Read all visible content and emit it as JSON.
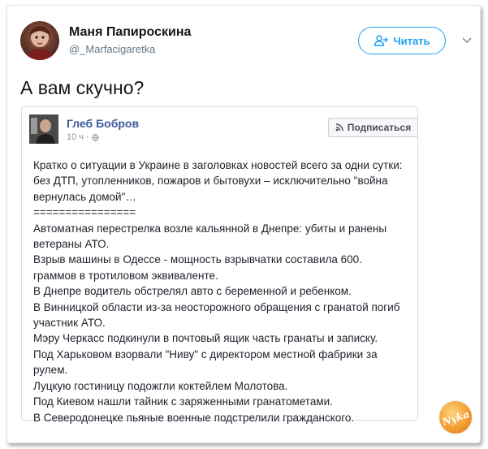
{
  "tweet": {
    "author_name": "Маня Папироскина",
    "author_handle": "@_Marfacigaretka",
    "follow_label": "Читать",
    "text": "А вам скучно?"
  },
  "quote": {
    "author_name": "Глеб Бобров",
    "time": "10 ч",
    "subscribe_label": "Подписаться",
    "lines": [
      "Кратко о ситуации в Украине в заголовках новостей всего за одни сутки:",
      "без ДТП, утопленников, пожаров и бытовухи – исключительно \"война",
      "вернулась домой\"…",
      "================",
      "Автоматная перестрелка возле кальянной в Днепре: убиты и ранены",
      "ветераны АТО.",
      "Взрыв машины в Одессе - мощность взрывчатки составила 600.",
      "граммов в тротиловом эквиваленте.",
      "В Днепре водитель обстрелял авто с беременной и ребенком.",
      "В Винницкой области из-за неосторожного обращения с гранатой погиб",
      "участник АТО.",
      "Мэру Черкасс подкинули в почтовый ящик часть гранаты и записку.",
      "Под Харьковом взорвали \"Ниву\" с директором местной фабрики за",
      "рулем.",
      "Луцкую гостиницу подожгли коктейлем Молотова.",
      "Под Киевом нашли тайник с заряженными гранатометами.",
      "В Северодонецке пьяные военные подстрелили гражданского."
    ]
  },
  "watermark": {
    "text": "Nyka"
  },
  "colors": {
    "twitter_blue": "#1da1f2",
    "facebook_link": "#3b5998",
    "muted": "#657786"
  }
}
